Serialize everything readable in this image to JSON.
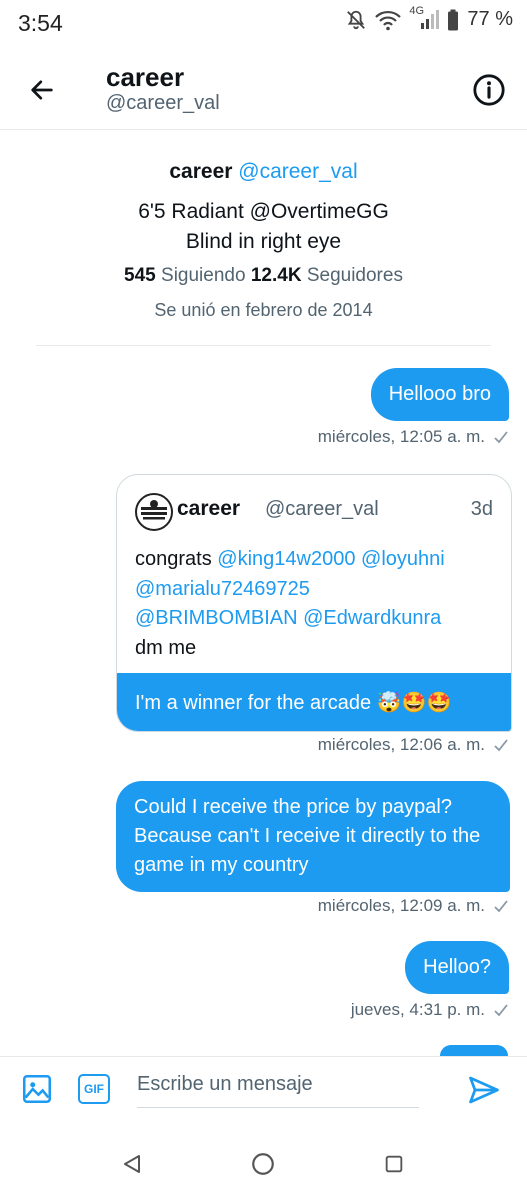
{
  "status_bar": {
    "time": "3:54",
    "icons": [
      "mute-icon",
      "wifi-icon",
      "signal-4g-icon",
      "battery-icon"
    ],
    "network": "4G",
    "battery": "77 %"
  },
  "header": {
    "name": "career",
    "handle": "@career_val",
    "back_icon": "arrow-left-icon",
    "info_icon": "info-icon"
  },
  "profile": {
    "name": "career",
    "handle": "@career_val",
    "bio_line1": "6'5 Radiant @OvertimeGG",
    "bio_line2": "Blind in right eye",
    "following_count": "545",
    "following_label": "Siguiendo",
    "followers_count": "12.4K",
    "followers_label": "Seguidores",
    "joined": "Se unió en febrero de 2014"
  },
  "messages": [
    {
      "text": "Hellooo bro",
      "time": "miércoles, 12:05 a. m."
    },
    {
      "quote": {
        "name": "career",
        "handle": "@career_val",
        "age": "3d",
        "text_prefix": "congrats",
        "mentions": [
          "@king14w2000",
          "@loyuhni",
          "@marialu72469725",
          "@BRIMBOMBIAN",
          "@Edwardkunra"
        ],
        "text_suffix": "dm me"
      },
      "text": "I'm a winner for the arcade 🤯🤩🤩",
      "time": "miércoles, 12:06 a. m."
    },
    {
      "text": "Could I receive the price by paypal? Because can't I receive it directly to the game in my country",
      "time": "miércoles, 12:09 a. m."
    },
    {
      "text": "Helloo?",
      "time": "jueves, 4:31 p. m."
    }
  ],
  "composer": {
    "placeholder": "Escribe un mensaje",
    "gif_label": "GIF"
  },
  "colors": {
    "accent": "#1d9bf0",
    "text": "#0f1419",
    "muted": "#536471"
  }
}
